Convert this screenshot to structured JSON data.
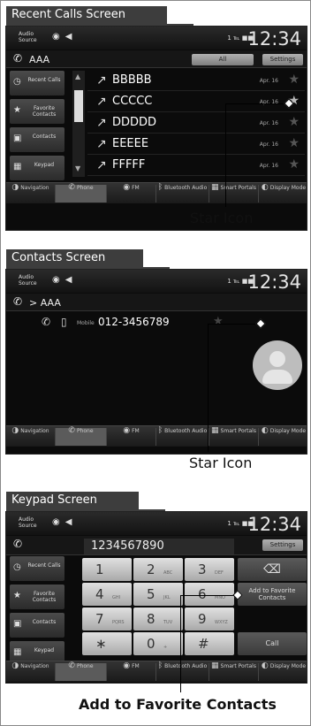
{
  "status": {
    "audio_source": "Audio\nSource",
    "clock": "12:34",
    "signal": "1 ℡ ■■"
  },
  "bottombar": [
    {
      "label": "Navigation",
      "icon": "navigation-icon"
    },
    {
      "label": "Phone",
      "icon": "phone-icon"
    },
    {
      "label": "FM",
      "icon": "radio-icon"
    },
    {
      "label": "Bluetooth Audio",
      "icon": "bluetooth-icon"
    },
    {
      "label": "Smart Portals",
      "icon": "smart-portals-icon"
    },
    {
      "label": "Display Mode",
      "icon": "display-mode-icon"
    }
  ],
  "leftnav": {
    "recent": "Recent Calls",
    "favorites": "Favorite Contacts",
    "contacts": "Contacts",
    "keypad": "Keypad"
  },
  "recent_calls": {
    "section_label": "Recent Calls Screen",
    "header_title": "AAA",
    "all_button": "All",
    "settings_button": "Settings",
    "rows": [
      {
        "name": "BBBBB",
        "date": "Apr. 16",
        "starred": false
      },
      {
        "name": "CCCCC",
        "date": "Apr. 16",
        "starred": true
      },
      {
        "name": "DDDDD",
        "date": "Apr. 16",
        "starred": false
      },
      {
        "name": "EEEEE",
        "date": "Apr. 16",
        "starred": false
      },
      {
        "name": "FFFFF",
        "date": "Apr. 16",
        "starred": false
      }
    ],
    "callout": "Star Icon"
  },
  "contacts": {
    "section_label": "Contacts Screen",
    "header_title": "> AAA",
    "type": "Mobile",
    "number": "012-3456789",
    "callout": "Star Icon"
  },
  "keypad": {
    "section_label": "Keypad Screen",
    "number": "1234567890",
    "settings_button": "Settings",
    "keys": [
      {
        "d": "1",
        "l": ""
      },
      {
        "d": "2",
        "l": "ABC"
      },
      {
        "d": "3",
        "l": "DEF"
      },
      {
        "d": "4",
        "l": "GHI"
      },
      {
        "d": "5",
        "l": "JKL"
      },
      {
        "d": "6",
        "l": "MNO"
      },
      {
        "d": "7",
        "l": "PQRS"
      },
      {
        "d": "8",
        "l": "TUV"
      },
      {
        "d": "9",
        "l": "WXYZ"
      },
      {
        "d": "∗",
        "l": ""
      },
      {
        "d": "0",
        "l": "+"
      },
      {
        "d": "#",
        "l": ""
      }
    ],
    "backspace": "⌫",
    "add_fav": "Add to Favorite Contacts",
    "call": "Call",
    "callout": "Add to Favorite Contacts"
  }
}
